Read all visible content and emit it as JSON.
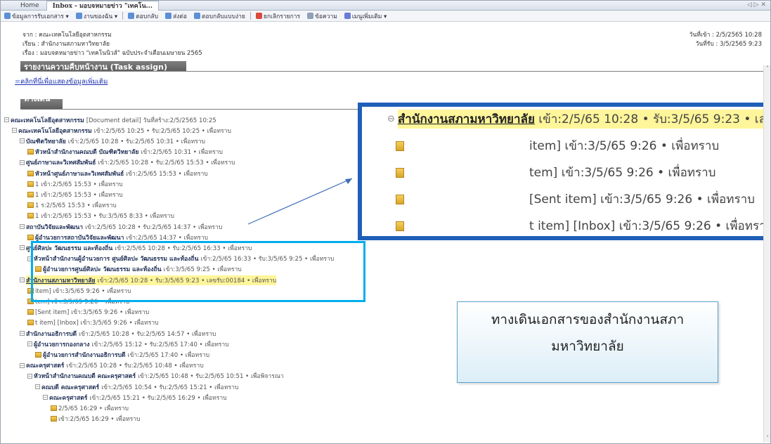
{
  "titlebar": {
    "home": "Home",
    "tab": "Inbox - มอบจหมายข่าว \"เทคโน...",
    "controls": "◁ ▷ ✕"
  },
  "toolbar": {
    "items": [
      {
        "label": "ข้อมูลการรับเอกสาร ▾",
        "color": "#5b8fd6"
      },
      {
        "label": "งานของฉัน ▾",
        "color": "#5b8fd6"
      },
      {
        "label": "ตอบกลับ",
        "color": "#5b8fd6"
      },
      {
        "label": "ส่งต่อ",
        "color": "#5b8fd6"
      },
      {
        "label": "ตอบกลับแบบง่าย",
        "color": "#5b8fd6"
      },
      {
        "label": "ยกเลิกรายการ",
        "color": "#d94a3a"
      },
      {
        "label": "ข้อความ",
        "color": "#8fa0b8"
      },
      {
        "label": "เมนูเพิ่มเติม ▾",
        "color": "#6a7bd9"
      }
    ]
  },
  "header": {
    "from": "จาก : คณะเทคโนโลยีอุตสาหกรรม",
    "to": "เรียน : สำนักงานสภามหาวิทยาลัย",
    "subject": "เรื่อง : มอบจดหมายข่าว \"เทคโนนิวส์\" ฉบับประจำเดือนเมษายน 2565",
    "sent_date": "วันที่เข้า : 2/5/2565 10:28",
    "recv_date": "วันที่รับ : 3/5/2565 9:23"
  },
  "sections": {
    "task": "รายงานความคืบหน้างาน (Task assign)",
    "more_link": "คลิกที่นี่เพื่อแสดงข้อมูลเพิ่มเติม",
    "path": "ทางเดินเอกสาร"
  },
  "tree": [
    {
      "indent": 0,
      "icon": "toggle",
      "bold": "คณะเทคโนโลยีอุตสาหกรรม",
      "text": "[Document detail] วันที่สร้าง:2/5/2565 10:25"
    },
    {
      "indent": 1,
      "icon": "toggle",
      "bold": "คณะเทคโนโลยีอุตสาหกรรม",
      "text": "เข้า:2/5/65 10:25 • รับ:2/5/65 10:25 • เพื่อทราบ"
    },
    {
      "indent": 2,
      "icon": "toggle",
      "bold": "บัณฑิตวิทยาลัย",
      "text": "เข้า:2/5/65 10:28 • รับ:2/5/65 10:31 • เพื่อทราบ"
    },
    {
      "indent": 3,
      "icon": "doc",
      "bold": "หัวหน้าสำนักงานคณบดี บัณฑิตวิทยาลัย",
      "text": "เข้า:2/5/65 10:31 • เพื่อทราบ"
    },
    {
      "indent": 2,
      "icon": "toggle",
      "bold": "ศูนย์ภาษาและวิเทศสัมพันธ์",
      "text": "เข้า:2/5/65 10:28 • รับ:2/5/65 15:53 • เพื่อทราบ"
    },
    {
      "indent": 3,
      "icon": "doc",
      "bold": "หัวหน้าศูนย์ภาษาและวิเทศสัมพันธ์",
      "text": "เข้า:2/5/65 15:53 • เพื่อทราบ"
    },
    {
      "indent": 3,
      "icon": "doc",
      "bold": "",
      "text": "1                          เข้า:2/5/65 15:53 • เพื่อทราบ"
    },
    {
      "indent": 3,
      "icon": "doc",
      "bold": "",
      "text": "1                          เข้า:2/5/65 15:53 • เพื่อทราบ"
    },
    {
      "indent": 3,
      "icon": "doc",
      "bold": "",
      "text": "1                          ร:2/5/65 15:53 • เพื่อทราบ"
    },
    {
      "indent": 3,
      "icon": "doc",
      "bold": "",
      "text": "1                          เข้า:2/5/65 15:53 • รับ:3/5/65 8:33 • เพื่อทราบ"
    },
    {
      "indent": 2,
      "icon": "toggle",
      "bold": "สถาบันวิจัยและพัฒนา",
      "text": "เข้า:2/5/65 10:28 • รับ:2/5/65 14:37 • เพื่อทราบ"
    },
    {
      "indent": 3,
      "icon": "doc",
      "bold": "ผู้อำนวยการสถาบันวิจัยและพัฒนา",
      "text": "เข้า:2/5/65 14:37 • เพื่อทราบ"
    },
    {
      "indent": 2,
      "icon": "toggle",
      "bold": "ศูนย์ศิลปะ วัฒนธรรม และท้องถิ่น",
      "text": "เข้า:2/5/65 10:28 • รับ:2/5/65 16:33 • เพื่อทราบ"
    },
    {
      "indent": 3,
      "icon": "toggle",
      "bold": "หัวหน้าสำนักงานผู้อำนวยการ ศูนย์ศิลปะ วัฒนธรรม และท้องถิ่น",
      "text": "เข้า:2/5/65 16:33 • รับ:3/5/65 9:25 • เพื่อทราบ"
    },
    {
      "indent": 4,
      "icon": "doc",
      "bold": "ผู้อำนวยการศูนย์ศิลปะ วัฒนธรรม และท้องถิ่น",
      "text": "เข้า:3/5/65 9:25 • เพื่อทราบ"
    },
    {
      "indent": 2,
      "icon": "toggle",
      "bold": "สำนักงานสภามหาวิทยาลัย",
      "text": "เข้า:2/5/65 10:28 • รับ:3/5/65 9:23 • เลขรับ:00184 • เพื่อทราบ",
      "highlight": true
    },
    {
      "indent": 3,
      "icon": "doc",
      "bold": "",
      "text": "                                 item] เข้า:3/5/65 9:26 • เพื่อทราบ"
    },
    {
      "indent": 3,
      "icon": "doc",
      "bold": "",
      "text": "                                 tem] เข้า:3/5/65 9:26 • เพื่อทราบ"
    },
    {
      "indent": 3,
      "icon": "doc",
      "bold": "",
      "text": "                                 [Sent item] เข้า:3/5/65 9:26 • เพื่อทราบ"
    },
    {
      "indent": 3,
      "icon": "doc",
      "bold": "",
      "text": "                                 t item] [Inbox] เข้า:3/5/65 9:26 • เพื่อทราบ"
    },
    {
      "indent": 2,
      "icon": "toggle",
      "bold": "สำนักงานอธิการบดี",
      "text": "เข้า:2/5/65 10:28 • รับ:2/5/65 14:57 • เพื่อทราบ"
    },
    {
      "indent": 3,
      "icon": "toggle",
      "bold": "ผู้อำนวยการกองกลาง",
      "text": "เข้า:2/5/65 15:12 • รับ:2/5/65 17:40 • เพื่อทราบ"
    },
    {
      "indent": 4,
      "icon": "doc",
      "bold": "ผู้อำนวยการสำนักงานอธิการบดี",
      "text": "เข้า:2/5/65 17:40 • เพื่อทราบ"
    },
    {
      "indent": 2,
      "icon": "toggle",
      "bold": "คณะครุศาสตร์",
      "text": "เข้า:2/5/65 10:28 • รับ:2/5/65 10:48 • เพื่อทราบ"
    },
    {
      "indent": 3,
      "icon": "toggle",
      "bold": "หัวหน้าสำนักงานคณบดี คณะครุศาสตร์",
      "text": "เข้า:2/5/65 10:48 • รับ:2/5/65 10:51 • เพื่อพิจารณา"
    },
    {
      "indent": 4,
      "icon": "toggle",
      "bold": "คณบดี คณะครุศาสตร์",
      "text": "เข้า:2/5/65 10:54 • รับ:2/5/65 15:21 • เพื่อทราบ"
    },
    {
      "indent": 5,
      "icon": "toggle",
      "bold": "คณะครุศาสตร์",
      "text": "เข้า:2/5/65 15:21 • รับ:2/5/65 16:29 • เพื่อทราบ"
    },
    {
      "indent": 6,
      "icon": "doc",
      "bold": "",
      "text": "                    2/5/65 16:29 • เพื่อทราบ"
    },
    {
      "indent": 6,
      "icon": "doc",
      "bold": "",
      "text": "                    เข้า:2/5/65 16:29 • เพื่อทราบ"
    }
  ],
  "zoom": {
    "rows": [
      {
        "bold": "สำนักงานสภามหาวิทยาลัย",
        "text": "เข้า:2/5/65 10:28 • รับ:3/5/65 9:23 • เลขรับ:00184 • เพื่อทราบ"
      },
      {
        "bold": "",
        "text": "item] เข้า:3/5/65 9:26 • เพื่อทราบ"
      },
      {
        "bold": "",
        "text": "tem] เข้า:3/5/65 9:26 • เพื่อทราบ"
      },
      {
        "bold": "",
        "text": "[Sent item] เข้า:3/5/65 9:26 • เพื่อทราบ"
      },
      {
        "bold": "",
        "text": "t item] [Inbox] เข้า:3/5/65 9:26 • เพื่อทราบ"
      }
    ]
  },
  "note": {
    "line1": "ทางเดินเอกสารของสำนักงานสภา",
    "line2": "มหาวิทยาลัย"
  },
  "colors": {
    "callout": "#00aeef",
    "zoom_border": "#1f5fb8",
    "highlight": "#fff59a"
  }
}
